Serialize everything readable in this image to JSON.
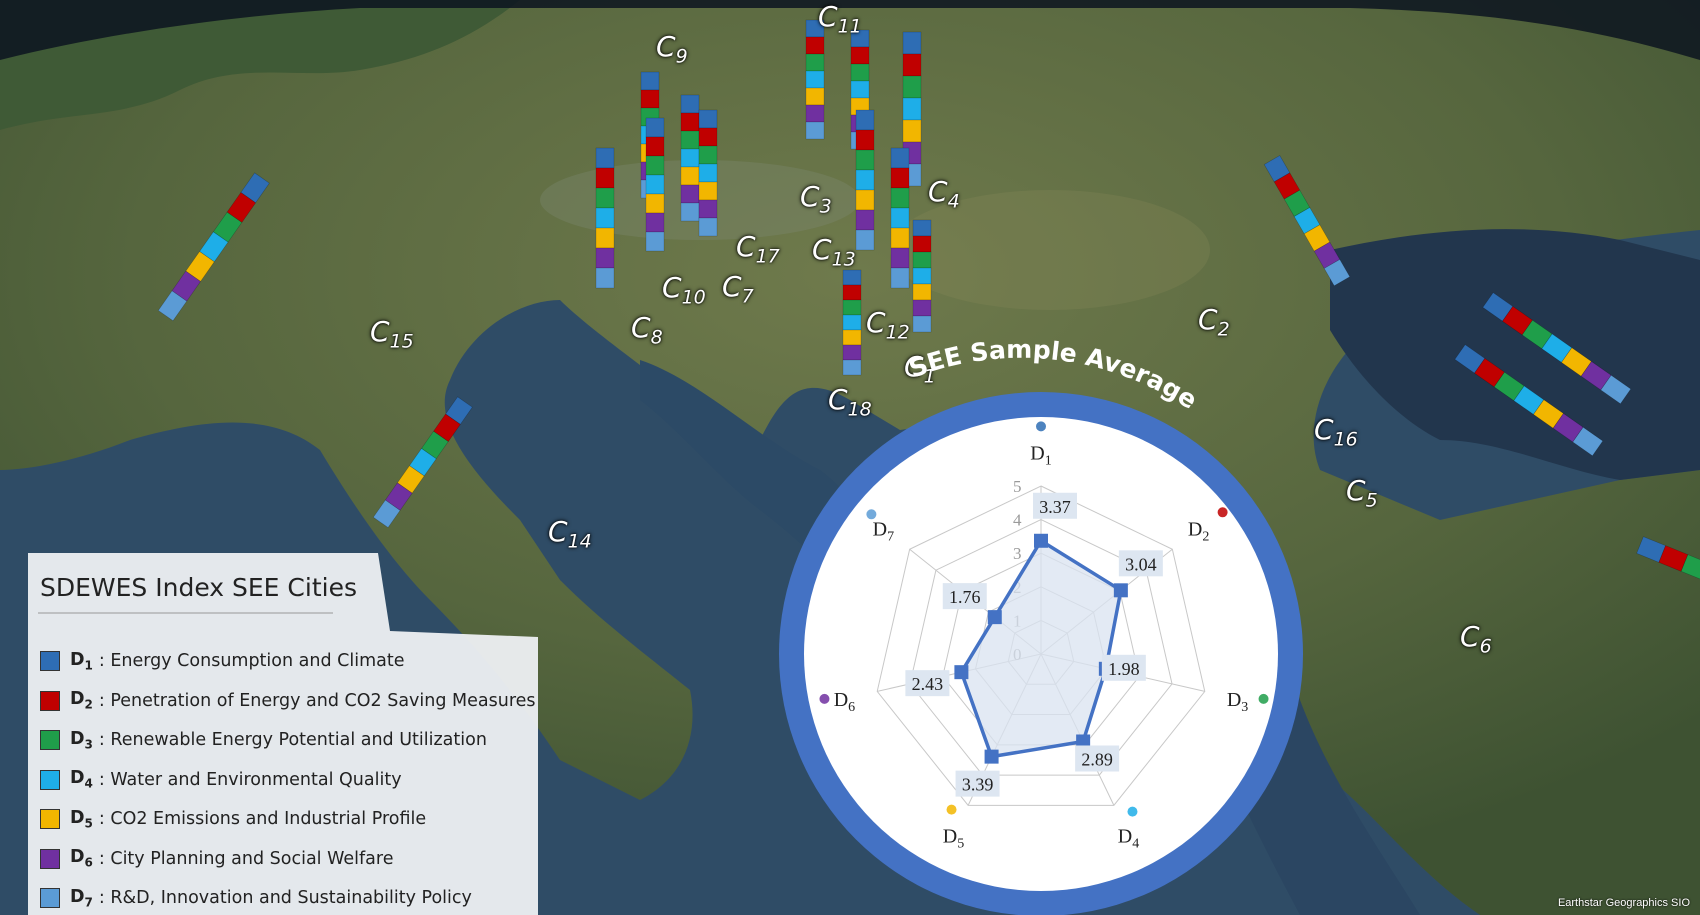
{
  "legend": {
    "title": "SDEWES Index SEE Cities",
    "items": [
      {
        "code": "D1",
        "code_main": "D",
        "code_sub": "1",
        "text": ": Energy Consumption and Climate",
        "color": "#2e6db4"
      },
      {
        "code": "D2",
        "code_main": "D",
        "code_sub": "2",
        "text": ": Penetration of Energy and CO2 Saving Measures",
        "color": "#c00000"
      },
      {
        "code": "D3",
        "code_main": "D",
        "code_sub": "3",
        "text": ": Renewable Energy Potential and Utilization",
        "color": "#1f9e4a"
      },
      {
        "code": "D4",
        "code_main": "D",
        "code_sub": "4",
        "text": ": Water and Environmental Quality",
        "color": "#1eaee8"
      },
      {
        "code": "D5",
        "code_main": "D",
        "code_sub": "5",
        "text": ": CO2 Emissions and Industrial Profile",
        "color": "#f2b600"
      },
      {
        "code": "D6",
        "code_main": "D",
        "code_sub": "6",
        "text": ": City Planning and Social Welfare",
        "color": "#7030a0"
      },
      {
        "code": "D7",
        "code_main": "D",
        "code_sub": "7",
        "text": ": R&D, Innovation and Sustainability Policy",
        "color": "#5b9bd5"
      }
    ]
  },
  "cities": [
    "C1",
    "C2",
    "C3",
    "C4",
    "C5",
    "C6",
    "C7",
    "C8",
    "C9",
    "C10",
    "C11",
    "C12",
    "C13",
    "C14",
    "C15",
    "C16",
    "C17",
    "C18"
  ],
  "credit": "Earthstar Geographics SIO",
  "chart_data": {
    "type": "radar",
    "title": "SEE Sample Average",
    "axes": [
      "D1",
      "D2",
      "D3",
      "D4",
      "D5",
      "D6",
      "D7"
    ],
    "values": [
      3.37,
      3.04,
      1.98,
      2.89,
      3.39,
      2.43,
      1.76
    ],
    "value_labels": [
      "3.37",
      "3.04",
      "1.98",
      "2.89",
      "3.39",
      "2.43",
      "1.76"
    ],
    "rlim": [
      0,
      5
    ],
    "ticks": [
      "0",
      "1",
      "2",
      "3",
      "4",
      "5"
    ],
    "series_color": "#4472c4",
    "fill_color": "#dae3f0",
    "ring_color": "#4472c4",
    "grid": true
  }
}
